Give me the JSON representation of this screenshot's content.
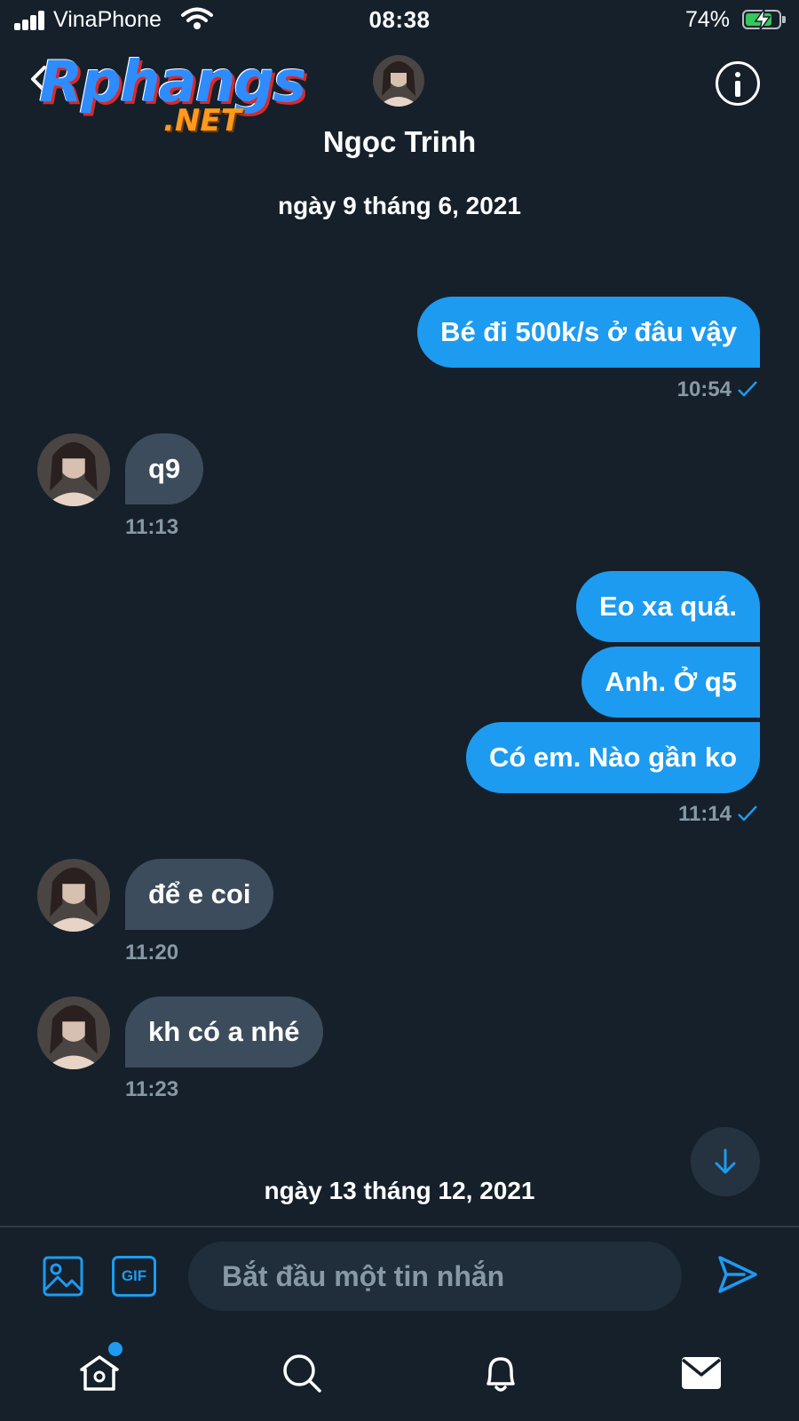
{
  "status_bar": {
    "carrier": "VinaPhone",
    "time": "08:38",
    "battery_percent": "74%",
    "battery_level": 0.74,
    "icons": [
      "signal-icon",
      "wifi-icon",
      "battery-charging-icon"
    ]
  },
  "watermark": {
    "logo_main": "Rphangs",
    "logo_sub": ".NET"
  },
  "header": {
    "contact_name": "Ngọc Trinh",
    "icons": [
      "back-icon",
      "info-icon"
    ]
  },
  "conversation": {
    "date_1": "ngày 9 tháng 6, 2021",
    "date_2": "ngày 13 tháng 12, 2021",
    "messages": [
      {
        "direction": "outgoing",
        "text": "Bé đi 500k/s  ở đâu vậy"
      },
      {
        "direction": "outgoing",
        "time": "10:54",
        "status": "sent"
      },
      {
        "direction": "incoming",
        "text": "q9",
        "time": "11:13"
      },
      {
        "direction": "outgoing",
        "text": "Eo xa quá."
      },
      {
        "direction": "outgoing",
        "text": "Anh. Ở q5"
      },
      {
        "direction": "outgoing",
        "text": "Có em. Nào gần ko",
        "time": "11:14",
        "status": "sent"
      },
      {
        "direction": "incoming",
        "text": "để e coi",
        "time": "11:20"
      },
      {
        "direction": "incoming",
        "text": "kh có a nhé",
        "time": "11:23"
      }
    ]
  },
  "composer": {
    "placeholder": "Bắt đầu một tin nhắn",
    "gif_label": "GIF",
    "icons": [
      "image-icon",
      "gif-icon",
      "send-icon"
    ]
  },
  "tab_bar": {
    "tabs": [
      "home-icon",
      "search-icon",
      "notifications-icon",
      "messages-icon"
    ],
    "home_has_notification": true
  },
  "colors": {
    "background": "#15202b",
    "accent": "#1d9bf0",
    "incoming_bubble": "#3c4c5d",
    "secondary_text": "#8899a6"
  }
}
